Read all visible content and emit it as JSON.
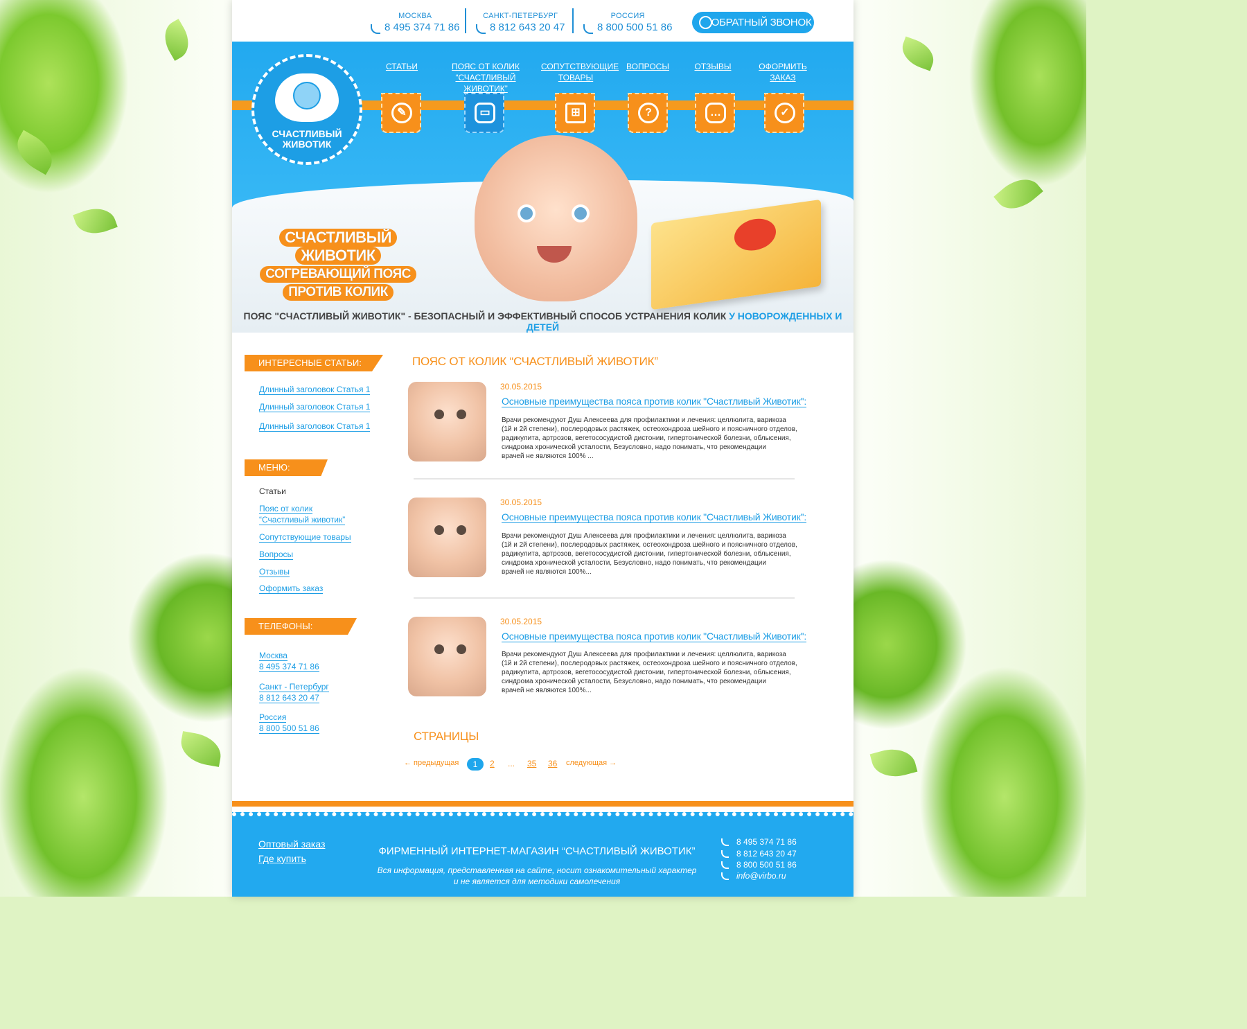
{
  "topbar": {
    "cities": [
      {
        "name": "МОСКВА",
        "phone": "8 495 374 71 86"
      },
      {
        "name": "САНКТ-ПЕТЕРБУРГ",
        "phone": "8 812 643 20 47"
      },
      {
        "name": "РОССИЯ",
        "phone": "8 800 500 51 86"
      }
    ],
    "callback_label": "ОБРАТНЫЙ ЗВОНОК"
  },
  "logo": {
    "line1": "СЧАСТЛИВЫЙ",
    "line2": "ЖИВОТИК"
  },
  "nav": [
    {
      "l1": "СТАТЬИ",
      "l2": "",
      "icon": "quill-icon"
    },
    {
      "l1": "ПОЯС ОТ КОЛИК",
      "l2": "“СЧАСТЛИВЫЙ ЖИВОТИК”",
      "icon": "belt-icon"
    },
    {
      "l1": "СОПУТСТВУЮЩИЕ",
      "l2": "ТОВАРЫ",
      "icon": "cart-icon"
    },
    {
      "l1": "ВОПРОСЫ",
      "l2": "",
      "icon": "question-icon"
    },
    {
      "l1": "ОТЗЫВЫ",
      "l2": "",
      "icon": "chat-bubble-icon"
    },
    {
      "l1": "ОФОРМИТЬ",
      "l2": "ЗАКАЗ",
      "icon": "checkmark-icon"
    }
  ],
  "promo": {
    "line1": "СЧАСТЛИВЫЙ",
    "line2": "ЖИВОТИК",
    "line3": "СОГРЕВАЮЩИЙ ПОЯС",
    "line4": "ПРОТИВ КОЛИК"
  },
  "tagline": {
    "main": "ПОЯС \"СЧАСТЛИВЫЙ ЖИВОТИК\" - БЕЗОПАСНЫЙ И ЭФФЕКТИВНЫЙ СПОСОБ УСТРАНЕНИЯ КОЛИК",
    "highlight": "У НОВОРОЖДЕННЫХ И ДЕТЕЙ"
  },
  "sidebar": {
    "articles_title": "ИНТЕРЕСНЫЕ СТАТЬИ:",
    "articles": [
      "Длинный заголовок Статья 1",
      "Длинный заголовок Статья 1",
      "Длинный заголовок Статья 1"
    ],
    "menu_title": "МЕНЮ:",
    "menu": [
      "Статьи",
      "Пояс от колик",
      "“Счастливый животик”",
      "Сопутствующие товары",
      "Вопросы",
      "Отзывы",
      "Оформить заказ"
    ],
    "phones_title": "ТЕЛЕФОНЫ:",
    "phones": [
      {
        "city": "Москва",
        "phone": "8 495 374 71 86"
      },
      {
        "city": "Санкт - Петербург",
        "phone": "8 812 643 20 47"
      },
      {
        "city": "Россия",
        "phone": "8 800 500 51 86"
      }
    ]
  },
  "main": {
    "title": "ПОЯС ОТ КОЛИК “СЧАСТЛИВЫЙ ЖИВОТИК”",
    "articles": [
      {
        "date": "30.05.2015",
        "title": "Основные преимущества пояса против колик \"Счастливый Животик\":",
        "l1": "Врачи рекомендуют Душ Алексеева для профилактики и лечения: целлюлита, варикоза",
        "l2": "(1й и 2й степени), послеродовых растяжек, остеохондроза шейного и поясничного отделов,",
        "l3": "радикулита,  артрозов, вегетососудистой дистонии, гипертонической болезни,  облысения,",
        "l4": "синдрома хронической усталости, Безусловно, надо понимать, что рекомендации",
        "l5": "врачей не являются 100% ..."
      },
      {
        "date": "30.05.2015",
        "title": "Основные преимущества пояса против колик \"Счастливый Животик\":",
        "l1": "Врачи рекомендуют Душ Алексеева для профилактики и лечения: целлюлита, варикоза",
        "l2": "(1й и 2й степени), послеродовых растяжек, остеохондроза шейного и поясничного отделов,",
        "l3": "радикулита,  артрозов, вегетососудистой дистонии, гипертонической болезни,  облысения,",
        "l4": "синдрома хронической усталости, Безусловно, надо понимать, что рекомендации",
        "l5": "врачей не являются 100%..."
      },
      {
        "date": "30.05.2015",
        "title": "Основные преимущества пояса против колик \"Счастливый Животик\":",
        "l1": "Врачи рекомендуют Душ Алексеева для профилактики и лечения: целлюлита, варикоза",
        "l2": "(1й и 2й степени), послеродовых растяжек, остеохондроза шейного и поясничного отделов,",
        "l3": "радикулита,  артрозов, вегетососудистой дистонии, гипертонической болезни,  облысения,",
        "l4": "синдрома хронической усталости, Безусловно, надо понимать, что рекомендации",
        "l5": "врачей не являются 100%..."
      }
    ],
    "pages_title": "СТРАНИЦЫ",
    "pager": {
      "prev": "← предыдущая",
      "pages": [
        "1",
        "2",
        "...",
        "35",
        "36"
      ],
      "next": "следующая →"
    }
  },
  "footer": {
    "links": [
      "Оптовый заказ",
      "Где купить"
    ],
    "title": "ФИРМЕННЫЙ ИНТЕРНЕТ-МАГАЗИН “СЧАСТЛИВЫЙ ЖИВОТИК”",
    "note1": "Вся информация, представленная на сайте, носит ознакомительный характер",
    "note2": "и не является для методики самолечения",
    "contacts": [
      "8 495 374 71 86",
      "8 812 643 20 47",
      "8 800 500 51 86",
      "info@virbo.ru"
    ]
  },
  "colors": {
    "brand_blue": "#22a9ef",
    "brand_orange": "#f7901b"
  }
}
